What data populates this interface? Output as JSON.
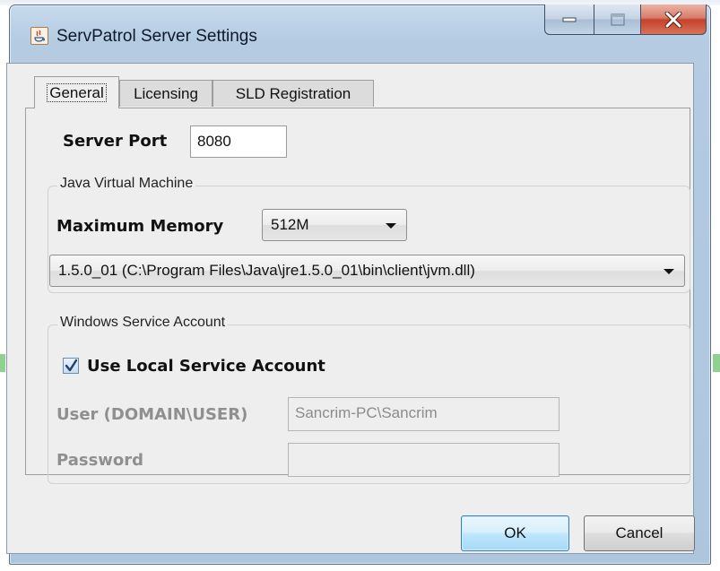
{
  "window": {
    "title": "ServPatrol Server Settings",
    "icon": "java-app-icon",
    "controls": {
      "minimize": "minimize-icon",
      "maximize": "maximize-icon",
      "close": "close-icon"
    }
  },
  "tabs": [
    {
      "label": "General",
      "active": true
    },
    {
      "label": "Licensing",
      "active": false
    },
    {
      "label": "SLD Registration",
      "active": false
    }
  ],
  "general": {
    "server_port_label": "Server Port",
    "server_port_value": "8080",
    "jvm_group_title": "Java Virtual Machine",
    "max_memory_label": "Maximum Memory",
    "max_memory_value": "512M",
    "jvm_selected": "1.5.0_01 (C:\\Program Files\\Java\\jre1.5.0_01\\bin\\client\\jvm.dll)",
    "service_group_title": "Windows Service Account",
    "use_local_label": "Use Local Service Account",
    "use_local_checked": true,
    "user_label": "User (DOMAIN\\USER)",
    "user_value": "Sancrim-PC\\Sancrim",
    "password_label": "Password",
    "password_value": ""
  },
  "buttons": {
    "ok": "OK",
    "cancel": "Cancel"
  },
  "colors": {
    "titlebar": "#b4cbe2",
    "close_button": "#c4422a",
    "ok_button": "#bee6fd",
    "client_bg": "#eeeeee"
  }
}
